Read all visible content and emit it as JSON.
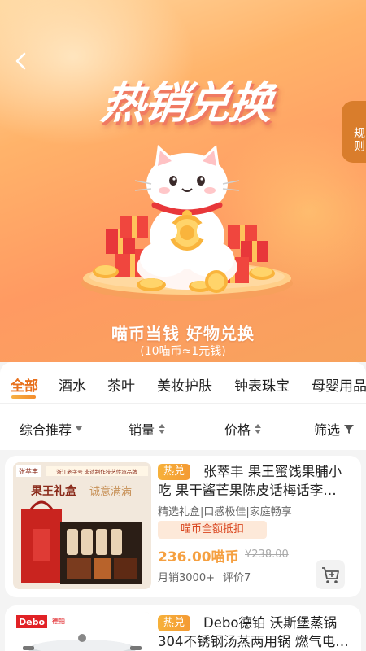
{
  "hero": {
    "title": "热销兑换",
    "rules_label": "规则",
    "slogan": "喵币当钱  好物兑换",
    "slogan_sub": "(10喵币≈1元钱)"
  },
  "categories": [
    "全部",
    "酒水",
    "茶叶",
    "美妆护肤",
    "钟表珠宝",
    "母婴用品"
  ],
  "active_category": "全部",
  "sort": {
    "default": "综合推荐",
    "sales": "销量",
    "price": "价格",
    "filter": "筛选"
  },
  "products": [
    {
      "badge": "热兑",
      "title": "张萃丰 果王蜜饯果脯小吃 果干酱芒果陈皮话梅话李…",
      "subtitle": "精选礼盒|口感极佳|家庭畅享",
      "deduct": "喵币全额抵扣",
      "price": "236.00喵币",
      "price_old": "¥238.00",
      "sales": "月销3000+",
      "reviews": "评价7",
      "image_text": {
        "brand": "张萃丰",
        "heritage": "浙江老字号  非遗制作技艺传承品牌",
        "gift": "果王礼盒",
        "tagline": "诚意满满"
      }
    },
    {
      "badge": "热兑",
      "title": "Debo德铂 沃斯堡蒸锅304不锈钢汤蒸两用锅 燃气电…",
      "image_text": {
        "brand": "Debo",
        "brand_cn": "德铂"
      }
    }
  ],
  "colors": {
    "accent": "#e8711d",
    "price": "#f5a041",
    "deduct_text": "#d9461f",
    "badge": "#f6b13a"
  }
}
